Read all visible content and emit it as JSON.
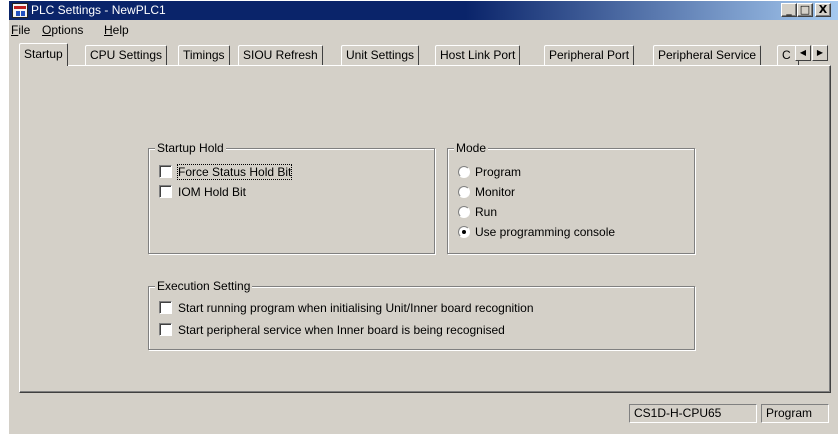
{
  "window": {
    "title": "PLC Settings - NewPLC1",
    "minimize": "_",
    "maximize": "□",
    "close": "X"
  },
  "menu": {
    "file_u": "F",
    "file_rest": "ile",
    "options_u": "O",
    "options_rest": "ptions",
    "help_u": "H",
    "help_rest": "elp"
  },
  "tabs": [
    "Startup",
    "CPU Settings",
    "Timings",
    "SIOU Refresh",
    "Unit Settings",
    "Host Link Port",
    "Peripheral Port",
    "Peripheral Service",
    "C"
  ],
  "tab_scroll": {
    "left": "◀",
    "right": "▶"
  },
  "startup_hold": {
    "legend": "Startup Hold",
    "items": [
      {
        "label": "Force Status Hold Bit",
        "checked": false
      },
      {
        "label": "IOM Hold Bit",
        "checked": false
      }
    ]
  },
  "mode": {
    "legend": "Mode",
    "options": [
      {
        "label": "Program",
        "selected": false
      },
      {
        "label": "Monitor",
        "selected": false
      },
      {
        "label": "Run",
        "selected": false
      },
      {
        "label": "Use programming console",
        "selected": true
      }
    ]
  },
  "execution": {
    "legend": "Execution Setting",
    "items": [
      {
        "label": "Start running program when initialising Unit/Inner board recognition",
        "checked": false
      },
      {
        "label": "Start peripheral service when Inner board is being recognised",
        "checked": false
      }
    ]
  },
  "status": {
    "cpu": "CS1D-H-CPU65",
    "mode": "Program"
  }
}
